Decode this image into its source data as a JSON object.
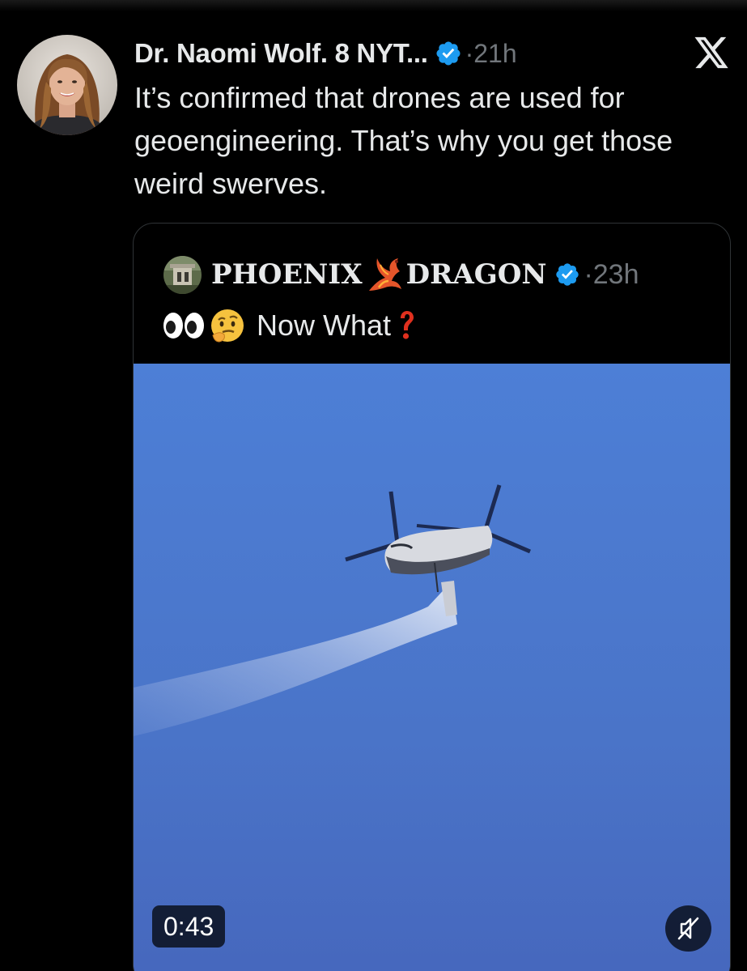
{
  "tweet": {
    "author_name": "Dr. Naomi Wolf. 8 NYT...",
    "time_ago": "·21h",
    "text": "It’s confirmed that drones are used for geoengineering. That’s why you get those weird swerves.",
    "verified": true
  },
  "quoted_tweet": {
    "author_name_part1": "PHOENIX",
    "author_name_part2": "DRAGON",
    "time_ago": "·23h",
    "text": "Now What",
    "emoji_prefix": [
      "eyes-icon",
      "thinking-face-icon"
    ],
    "emoji_suffix": "red-question-mark-icon",
    "verified": true
  },
  "video": {
    "duration": "0:43",
    "muted": true
  },
  "icons": {
    "verified": "verified-badge-icon",
    "platform": "x-logo-icon",
    "mute": "speaker-muted-icon",
    "name_emoji": "phoenix-icon"
  },
  "colors": {
    "background": "#000000",
    "text_primary": "#e7e9ea",
    "text_secondary": "#71767b",
    "verified_blue": "#1d9bf0",
    "card_border": "#2f3336",
    "video_sky": "#4a73c8"
  }
}
